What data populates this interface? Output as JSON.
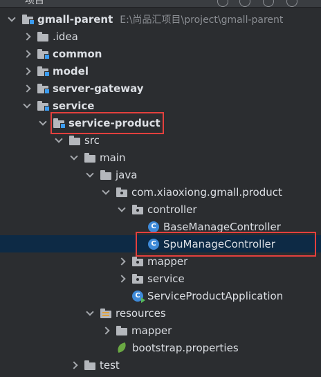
{
  "window": {
    "clipped_title": "项目"
  },
  "tree": [
    {
      "label": "gmall-parent",
      "hint": "E:\\尚品汇项目\\project\\gmall-parent",
      "bold": true,
      "icon": "module-folder-icon",
      "expanded": true,
      "selected": false,
      "highlighted": false
    },
    {
      "label": ".idea",
      "bold": false,
      "icon": "folder-icon",
      "expanded": false,
      "selected": false,
      "highlighted": false
    },
    {
      "label": "common",
      "bold": true,
      "icon": "module-folder-icon",
      "expanded": false,
      "selected": false,
      "highlighted": false
    },
    {
      "label": "model",
      "bold": true,
      "icon": "module-folder-icon",
      "expanded": false,
      "selected": false,
      "highlighted": false
    },
    {
      "label": "server-gateway",
      "bold": true,
      "icon": "module-folder-icon",
      "expanded": false,
      "selected": false,
      "highlighted": false
    },
    {
      "label": "service",
      "bold": true,
      "icon": "module-folder-icon",
      "expanded": true,
      "selected": false,
      "highlighted": false
    },
    {
      "label": "service-product",
      "bold": true,
      "icon": "module-folder-icon",
      "expanded": true,
      "selected": false,
      "highlighted": true
    },
    {
      "label": "src",
      "bold": false,
      "icon": "folder-icon",
      "expanded": true,
      "selected": false,
      "highlighted": false
    },
    {
      "label": "main",
      "bold": false,
      "icon": "folder-icon",
      "expanded": true,
      "selected": false,
      "highlighted": false
    },
    {
      "label": "java",
      "bold": false,
      "icon": "source-root-folder-icon",
      "expanded": true,
      "selected": false,
      "highlighted": false
    },
    {
      "label": "com.xiaoxiong.gmall.product",
      "bold": false,
      "icon": "package-icon",
      "expanded": true,
      "selected": false,
      "highlighted": false
    },
    {
      "label": "controller",
      "bold": false,
      "icon": "package-icon",
      "expanded": true,
      "selected": false,
      "highlighted": false
    },
    {
      "label": "BaseManageController",
      "bold": false,
      "icon": "java-class-icon",
      "expanded": null,
      "selected": false,
      "highlighted": false
    },
    {
      "label": "SpuManageController",
      "bold": false,
      "icon": "java-class-icon",
      "expanded": null,
      "selected": true,
      "highlighted": true
    },
    {
      "label": "mapper",
      "bold": false,
      "icon": "package-icon",
      "expanded": false,
      "selected": false,
      "highlighted": false
    },
    {
      "label": "service",
      "bold": false,
      "icon": "package-icon",
      "expanded": false,
      "selected": false,
      "highlighted": false
    },
    {
      "label": "ServiceProductApplication",
      "bold": false,
      "icon": "spring-boot-app-icon",
      "expanded": null,
      "selected": false,
      "highlighted": false
    },
    {
      "label": "resources",
      "bold": false,
      "icon": "resources-folder-icon",
      "expanded": true,
      "selected": false,
      "highlighted": false
    },
    {
      "label": "mapper",
      "bold": false,
      "icon": "folder-icon",
      "expanded": false,
      "selected": false,
      "highlighted": false
    },
    {
      "label": "bootstrap.properties",
      "bold": false,
      "icon": "spring-properties-icon",
      "expanded": null,
      "selected": false,
      "highlighted": false
    },
    {
      "label": "test",
      "bold": false,
      "icon": "folder-icon",
      "expanded": false,
      "selected": false,
      "highlighted": false
    }
  ],
  "colors": {
    "background": "#2b2d30",
    "selection": "#0d2a45",
    "highlight_border": "#e3403d",
    "module_marker": "#3c9cf0",
    "class_icon": "#3e8ad8"
  }
}
